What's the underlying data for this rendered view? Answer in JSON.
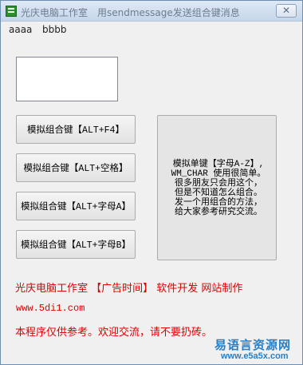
{
  "window": {
    "title": "光庆电脑工作室　用sendmessage发送组合键消息",
    "close_symbol": "✕"
  },
  "menu": {
    "items": [
      "aaaa",
      "bbbb"
    ]
  },
  "buttons": {
    "alt_f4": "模拟组合键【ALT+F4】",
    "alt_space": "模拟组合键【ALT+空格】",
    "alt_a": "模拟组合键【ALT+字母A】",
    "alt_b": "模拟组合键【ALT+字母B】",
    "single_key_lines": [
      "模拟单键【字母A-Z】,",
      "WM_CHAR 使用很简单。",
      "很多朋友只会用这个，",
      "但是不知道怎么组合。",
      "发一个用组合的方法，",
      "给大家参考研究交流。"
    ]
  },
  "footer": {
    "ad_line": "光庆电脑工作室 【广告时间】 软件开发  网站制作",
    "url": "www.5di1.com",
    "notice": "本程序仅供参考。欢迎交流，请不要扔砖。"
  },
  "watermark": {
    "name": "易语言资源网",
    "url": "www.e5a5x.com"
  },
  "colors": {
    "red_text": "#e00000",
    "watermark_blue": "#2a7fc4"
  }
}
